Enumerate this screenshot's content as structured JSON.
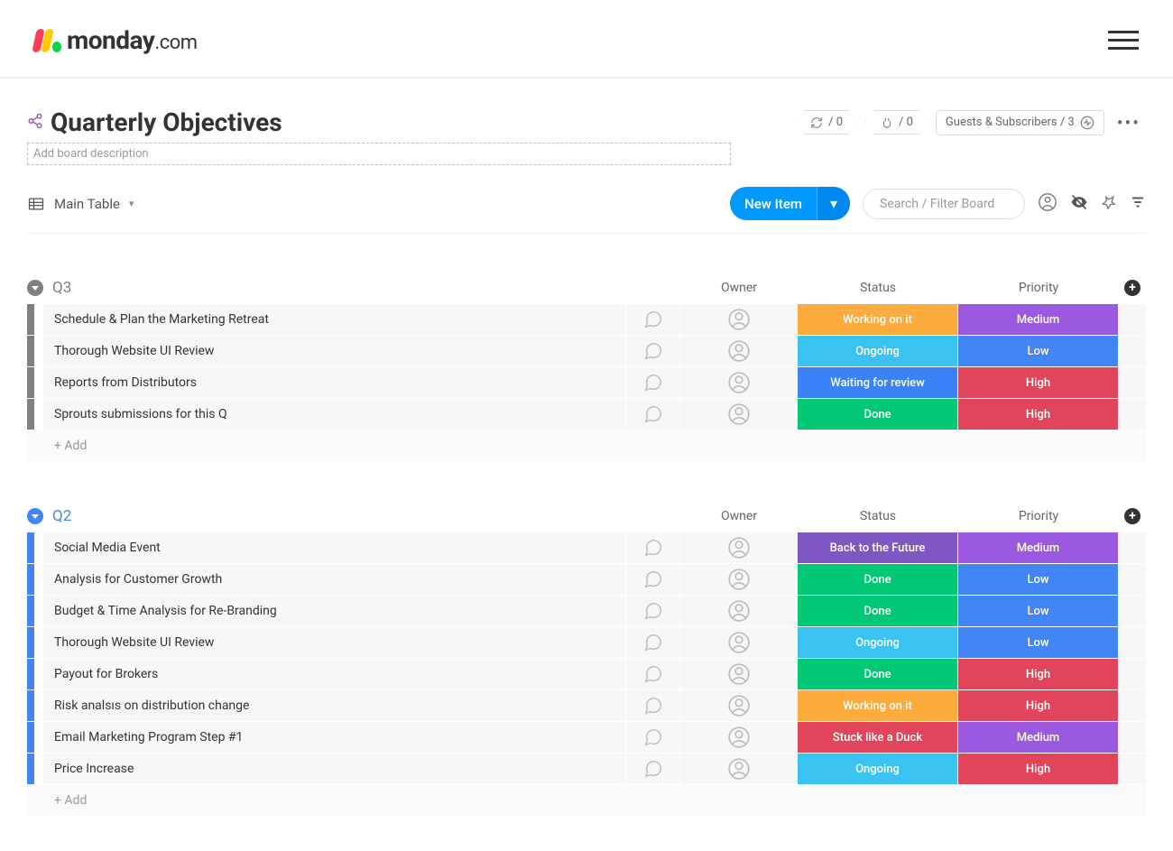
{
  "brand": {
    "name": "monday",
    "suffix": ".com"
  },
  "board": {
    "title": "Quarterly Objectives",
    "description_placeholder": "Add board description"
  },
  "header_pills": {
    "automations": "/ 0",
    "integrations": "/ 0",
    "guests": "Guests & Subscribers / 3"
  },
  "toolbar": {
    "view": "Main Table",
    "new_item": "New Item",
    "search_placeholder": "Search / Filter Board"
  },
  "columns": {
    "owner": "Owner",
    "status": "Status",
    "priority": "Priority"
  },
  "add_row": "+ Add",
  "status_colors": {
    "Working on it": "#fdab3d",
    "Ongoing": "#3ac2f0",
    "Waiting for review": "#3b82f6",
    "Done": "#00c875",
    "Back to the Future": "#7e57c2",
    "Stuck like a Duck": "#e2445c"
  },
  "priority_colors": {
    "Medium": "#9b59e0",
    "Low": "#4285f4",
    "High": "#e2445c"
  },
  "groups": [
    {
      "name": "Q3",
      "color": "#808080",
      "items": [
        {
          "name": "Schedule & Plan the Marketing Retreat",
          "status": "Working on it",
          "priority": "Medium"
        },
        {
          "name": "Thorough Website UI Review",
          "status": "Ongoing",
          "priority": "Low"
        },
        {
          "name": "Reports from Distributors",
          "status": "Waiting for review",
          "priority": "High"
        },
        {
          "name": "Sprouts submissions for this Q",
          "status": "Done",
          "priority": "High"
        }
      ]
    },
    {
      "name": "Q2",
      "color": "#4285f4",
      "items": [
        {
          "name": "Social Media Event",
          "status": "Back to the Future",
          "priority": "Medium"
        },
        {
          "name": "Analysis for Customer Growth",
          "status": "Done",
          "priority": "Low"
        },
        {
          "name": "Budget & Time Analysis for Re-Branding",
          "status": "Done",
          "priority": "Low"
        },
        {
          "name": "Thorough Website UI Review",
          "status": "Ongoing",
          "priority": "Low"
        },
        {
          "name": "Payout for Brokers",
          "status": "Done",
          "priority": "High"
        },
        {
          "name": "Risk analsıs on distribution change",
          "status": "Working on it",
          "priority": "High"
        },
        {
          "name": "Email Marketing Program Step #1",
          "status": "Stuck like a Duck",
          "priority": "Medium"
        },
        {
          "name": "Price Increase",
          "status": "Ongoing",
          "priority": "High"
        }
      ]
    }
  ]
}
